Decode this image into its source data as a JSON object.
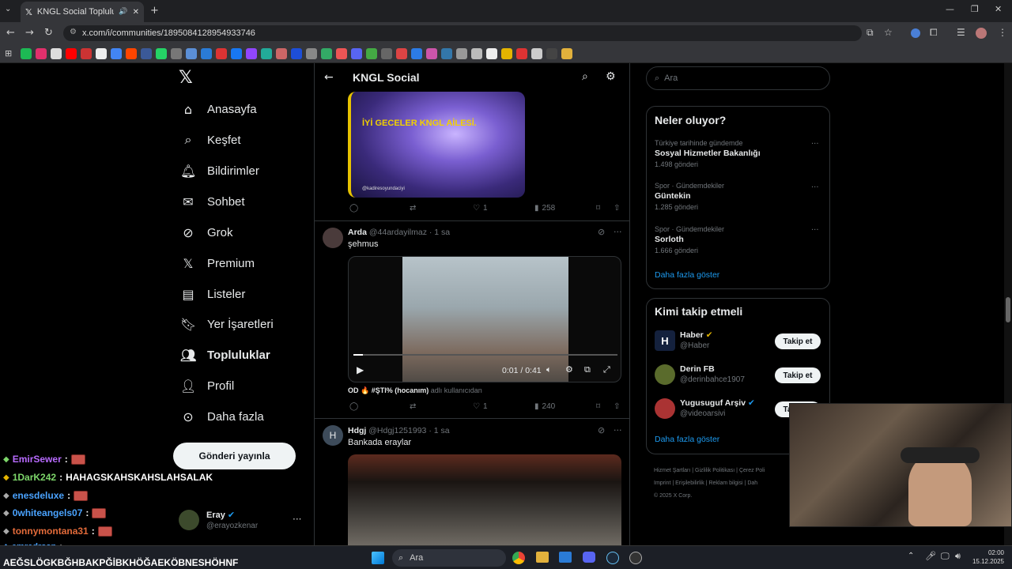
{
  "browser": {
    "tab_title": "KNGL Social Topluluk / X",
    "url": "x.com/i/communities/1895084128954933746"
  },
  "sidebar": {
    "items": [
      {
        "label": "Anasayfa",
        "icon": "home-icon"
      },
      {
        "label": "Keşfet",
        "icon": "search-icon"
      },
      {
        "label": "Bildirimler",
        "icon": "bell-icon"
      },
      {
        "label": "Sohbet",
        "icon": "mail-icon"
      },
      {
        "label": "Grok",
        "icon": "grok-icon"
      },
      {
        "label": "Premium",
        "icon": "x-logo-icon"
      },
      {
        "label": "Listeler",
        "icon": "list-icon"
      },
      {
        "label": "Yer İşaretleri",
        "icon": "bookmark-icon"
      },
      {
        "label": "Topluluklar",
        "icon": "communities-icon"
      },
      {
        "label": "Profil",
        "icon": "person-icon"
      },
      {
        "label": "Daha fazla",
        "icon": "more-circle-icon"
      }
    ],
    "post_button": "Gönderi yayınla",
    "account": {
      "name": "Eray",
      "handle": "@erayozkenar"
    }
  },
  "header": {
    "title": "KNGL Social"
  },
  "feed": {
    "post0": {
      "image_text": "İYİ GECELER KNGL AİLESİ.",
      "image_credit": "@kadiresoyundaciyi",
      "likes": "1",
      "views": "258"
    },
    "post1": {
      "name": "Arda",
      "handle": "@44ardayilmaz",
      "time": "· 1 sa",
      "text": "şehmus",
      "video_time": "0:01 / 0:41",
      "from_line": "OD 🔥 #ŞТl% (hocanım)",
      "from_suffix": "adlı kullanıcıdan",
      "likes": "1",
      "views": "240"
    },
    "post2": {
      "avatar_letter": "H",
      "name": "Hdgj",
      "handle": "@Hdgj1251993",
      "time": "· 1 sa",
      "text": "Bankada eraylar"
    }
  },
  "right": {
    "search_placeholder": "Ara",
    "trends_title": "Neler oluyor?",
    "trends": [
      {
        "context": "Türkiye tarihinde gündemde",
        "name": "Sosyal Hizmetler Bakanlığı",
        "count": "1.498 gönderi"
      },
      {
        "context": "Spor · Gündemdekiler",
        "name": "Güntekin",
        "count": "1.285 gönderi"
      },
      {
        "context": "Spor · Gündemdekiler",
        "name": "Sorloth",
        "count": "1.666 gönderi"
      }
    ],
    "show_more": "Daha fazla göster",
    "follow_title": "Kimi takip etmeli",
    "follow": [
      {
        "name": "Haber",
        "handle": "@Haber",
        "btn": "Takip et"
      },
      {
        "name": "Derin FB",
        "handle": "@derinbahce1907",
        "btn": "Takip et"
      },
      {
        "name": "Yugusuguf Arşiv",
        "handle": "@videoarsivi",
        "btn": "Takip et"
      }
    ],
    "footer": [
      "Hizmet Şartları",
      "|",
      "Gizlilik Politikası",
      "|",
      "Çerez Poli",
      "Imprint",
      "|",
      "Erişilebilirlik",
      "|",
      "Reklam bilgisi",
      "|",
      "Dah",
      "© 2025 X Corp."
    ]
  },
  "chat": [
    {
      "user": "EmirSewer",
      "color": "#b86bff",
      "msg": ""
    },
    {
      "user": "1DarK242",
      "color": "#7dd66a",
      "msg": "HAHAGSKAHSKAHSLAHSALAK"
    },
    {
      "user": "enesdeluxe",
      "color": "#4aa3ff",
      "msg": ""
    },
    {
      "user": "0whiteangels07",
      "color": "#4aa3ff",
      "msg": ""
    },
    {
      "user": "tonnymontana31",
      "color": "#e36b3a",
      "msg": ""
    },
    {
      "user": "emredrssn",
      "color": "#4aa3ff",
      "msg": ""
    }
  ],
  "chat_last": "AEĞSLÖGKBĞHBAKPĞİBKHÖĞAEKÖBNESHÖHNF",
  "taskbar": {
    "search": "Ara",
    "time": "02:00",
    "date": "15.12.2025"
  }
}
